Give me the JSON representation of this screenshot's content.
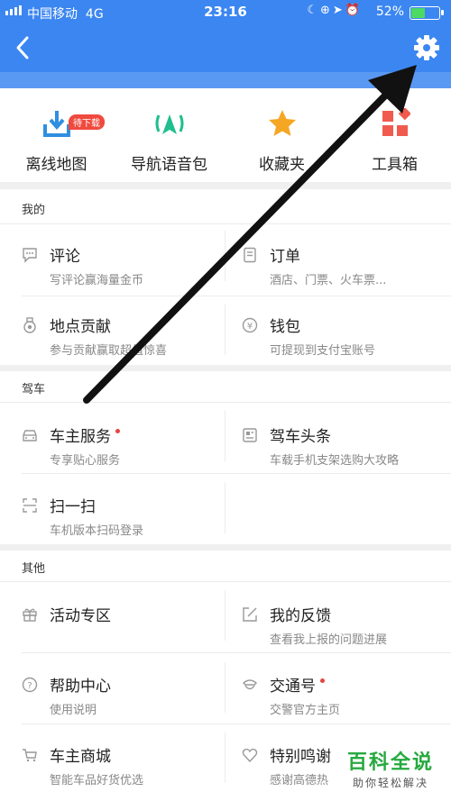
{
  "status_bar": {
    "carrier": "中国移动",
    "network": "4G",
    "time": "23:16",
    "battery": "52%",
    "battery_level": 0.52,
    "icons": [
      "moon-icon",
      "lock-rotation-icon",
      "location-icon",
      "alarm-icon"
    ]
  },
  "nav": {
    "back_icon": "back-chevron-icon",
    "settings_icon": "gear-icon"
  },
  "quick_actions": [
    {
      "label": "离线地图",
      "icon": "download-icon",
      "badge": "待下载"
    },
    {
      "label": "导航语音包",
      "icon": "navigation-voice-icon"
    },
    {
      "label": "收藏夹",
      "icon": "star-icon"
    },
    {
      "label": "工具箱",
      "icon": "toolbox-icon"
    }
  ],
  "sections": [
    {
      "title": "我的",
      "items": [
        {
          "title": "评论",
          "subtitle": "写评论赢海量金币",
          "icon": "comment-icon"
        },
        {
          "title": "订单",
          "subtitle": "酒店、门票、火车票...",
          "icon": "order-icon"
        },
        {
          "title": "地点贡献",
          "subtitle": "参与贡献赢取超值惊喜",
          "icon": "medal-icon"
        },
        {
          "title": "钱包",
          "subtitle": "可提现到支付宝账号",
          "icon": "wallet-icon"
        }
      ]
    },
    {
      "title": "驾车",
      "items": [
        {
          "title": "车主服务",
          "subtitle": "专享贴心服务",
          "icon": "car-icon",
          "dot": true
        },
        {
          "title": "驾车头条",
          "subtitle": "车载手机支架选购大攻略",
          "icon": "news-icon"
        },
        {
          "title": "扫一扫",
          "subtitle": "车机版本扫码登录",
          "icon": "scan-icon"
        }
      ]
    },
    {
      "title": "其他",
      "items": [
        {
          "title": "活动专区",
          "subtitle": "",
          "icon": "gift-icon"
        },
        {
          "title": "我的反馈",
          "subtitle": "查看我上报的问题进展",
          "icon": "feedback-icon"
        },
        {
          "title": "帮助中心",
          "subtitle": "使用说明",
          "icon": "help-icon"
        },
        {
          "title": "交通号",
          "subtitle": "交警官方主页",
          "icon": "police-icon",
          "dot": true
        },
        {
          "title": "车主商城",
          "subtitle": "智能车品好货优选",
          "icon": "cart-icon"
        },
        {
          "title": "特别鸣谢",
          "subtitle": "感谢高德热",
          "icon": "heart-icon"
        }
      ]
    }
  ],
  "watermark": {
    "title": "百科全说",
    "subtitle": "助你轻松解决"
  },
  "colors": {
    "header": "#3b86f1",
    "accent_blue": "#2f8fe0",
    "accent_green": "#1fbf8f",
    "star": "#f5a623",
    "toolbox": "#f05a4f",
    "badge": "#f04a3e",
    "arrow": "#111111"
  }
}
